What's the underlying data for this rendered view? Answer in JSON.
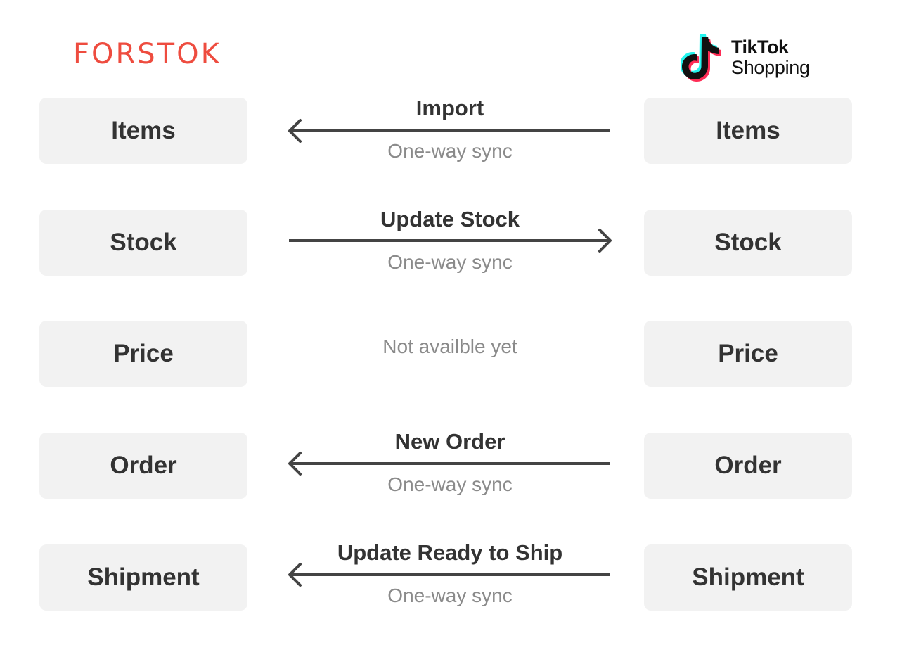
{
  "left_logo": {
    "text": "FORSTOK",
    "color": "#ee4c3f"
  },
  "right_logo": {
    "line1": "TikTok",
    "line2": "Shopping",
    "colors": {
      "cyan": "#25f4ee",
      "red": "#fe2c55",
      "black": "#111111"
    }
  },
  "rows": [
    {
      "left": "Items",
      "right": "Items",
      "label": "Import",
      "sub": "One-way sync",
      "direction": "left"
    },
    {
      "left": "Stock",
      "right": "Stock",
      "label": "Update Stock",
      "sub": "One-way sync",
      "direction": "right"
    },
    {
      "left": "Price",
      "right": "Price",
      "label": "",
      "sub": "Not availble yet",
      "direction": "none"
    },
    {
      "left": "Order",
      "right": "Order",
      "label": "New Order",
      "sub": "One-way sync",
      "direction": "left"
    },
    {
      "left": "Shipment",
      "right": "Shipment",
      "label": "Update Ready to Ship",
      "sub": "One-way sync",
      "direction": "left"
    }
  ]
}
